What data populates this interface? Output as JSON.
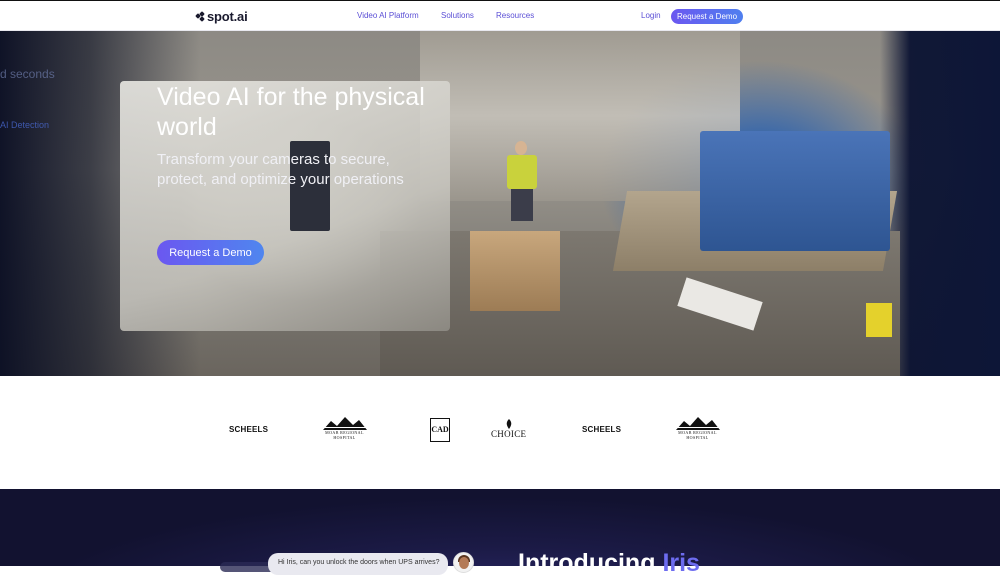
{
  "nav": {
    "logo_text": "spot.ai",
    "links": [
      "Video AI Platform",
      "Solutions",
      "Resources"
    ],
    "login": "Login",
    "cta": "Request a Demo"
  },
  "hero": {
    "title": "Video AI for the physical world",
    "subtitle": "Transform your cameras to secure, protect, and optimize your operations",
    "cta": "Request a Demo",
    "background_screen_text": [
      "d seconds",
      "AI Detection"
    ]
  },
  "logos": {
    "items": [
      {
        "name": "SCHEELS"
      },
      {
        "name": "MOAB REGIONAL",
        "subname": "HOSPITAL"
      },
      {
        "name": "CAD"
      },
      {
        "name": "CHOICE"
      },
      {
        "name": "SCHEELS"
      },
      {
        "name": "MOAB REGIONAL",
        "subname": "HOSPITAL"
      }
    ]
  },
  "iris": {
    "chat_text": "Hi Iris, can you unlock the doors when UPS arrives?",
    "title_prefix": "Introducing",
    "title_accent": "Iris"
  },
  "colors": {
    "accent": "#5b4fd6",
    "cta_gradient_start": "#6b57f0",
    "cta_gradient_end": "#4f86ef",
    "dark_bg": "#1b1a45"
  }
}
